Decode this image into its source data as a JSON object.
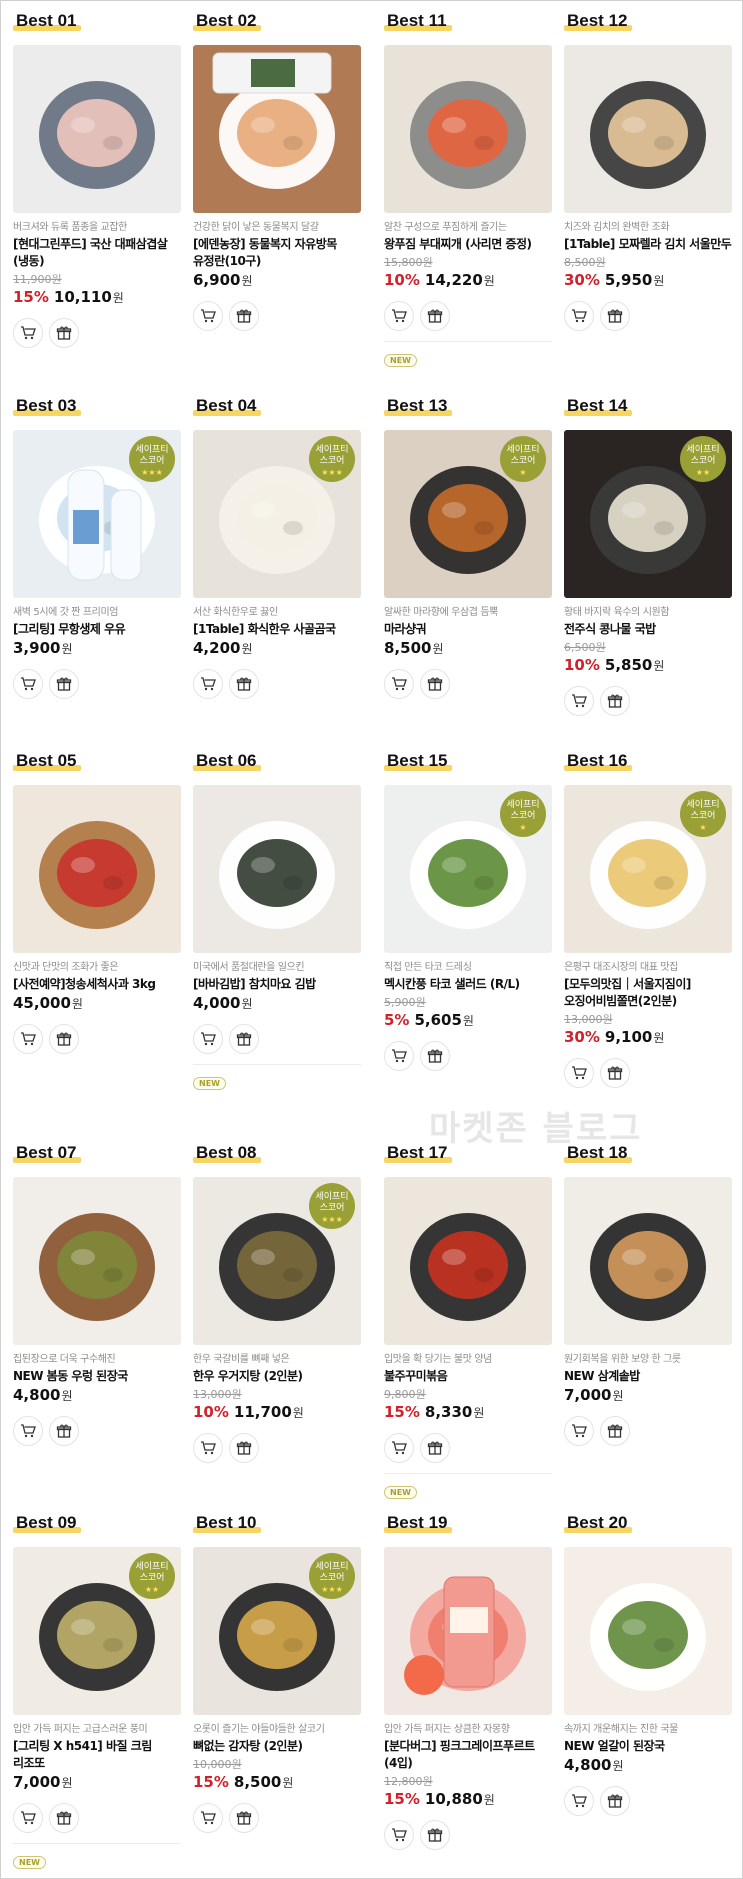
{
  "labels": {
    "safety_line1": "세이프티",
    "safety_line2": "스코어",
    "new_tag": "NEW",
    "currency": "원"
  },
  "watermark": "마켓존 블로그",
  "products": [
    {
      "rank": "Best 01",
      "desc": "버크셔와 듀록 품종을 교잡한",
      "name": "[현대그린푸드] 국산 대패삼겹살(냉동)",
      "orig": "11,900원",
      "discount": "15%",
      "price": "10,110",
      "safety": false,
      "is_new": false
    },
    {
      "rank": "Best 02",
      "desc": "건강한 닭이 낳은 동물복지 달걀",
      "name": "[에덴농장] 동물복지 자유방목 유정란(10구)",
      "orig": "",
      "discount": "",
      "price": "6,900",
      "safety": false,
      "is_new": false
    },
    {
      "rank": "Best 11",
      "desc": "알찬 구성으로 푸짐하게 즐기는",
      "name": "왕푸짐 부대찌개 (사리면 증정)",
      "orig": "15,800원",
      "discount": "10%",
      "price": "14,220",
      "safety": false,
      "is_new": true
    },
    {
      "rank": "Best 12",
      "desc": "치즈와 김치의 완벽한 조화",
      "name": "[1Table] 모짜렐라 김치 서울만두",
      "orig": "8,500원",
      "discount": "30%",
      "price": "5,950",
      "safety": false,
      "is_new": false
    },
    {
      "rank": "Best 03",
      "desc": "새벽 5시에 갓 짠 프리미엄",
      "name": "[그리팅] 무항생제 우유",
      "orig": "",
      "discount": "",
      "price": "3,900",
      "safety": true,
      "stars": "★★★",
      "is_new": false
    },
    {
      "rank": "Best 04",
      "desc": "서산 화식한우로 끓인",
      "name": "[1Table] 화식한우 사골곰국",
      "orig": "",
      "discount": "",
      "price": "4,200",
      "safety": true,
      "stars": "★★★",
      "is_new": false
    },
    {
      "rank": "Best 13",
      "desc": "알싸한 마라향에 우삼겹 듬뿍",
      "name": "마라샹궈",
      "orig": "",
      "discount": "",
      "price": "8,500",
      "safety": true,
      "stars": "★",
      "is_new": false
    },
    {
      "rank": "Best 14",
      "desc": "황태 바지락 육수의 시원함",
      "name": "전주식 콩나물 국밥",
      "orig": "6,500원",
      "discount": "10%",
      "price": "5,850",
      "safety": true,
      "stars": "★★",
      "is_new": false
    },
    {
      "rank": "Best 05",
      "desc": "신맛과 단맛의 조화가 좋은",
      "name": "[사전예약]청송세척사과 3kg",
      "orig": "",
      "discount": "",
      "price": "45,000",
      "safety": false,
      "is_new": false
    },
    {
      "rank": "Best 06",
      "desc": "미국에서 품절대란을 일으킨",
      "name": "[바바김밥] 참치마요 김밥",
      "orig": "",
      "discount": "",
      "price": "4,000",
      "safety": false,
      "is_new": true
    },
    {
      "rank": "Best 15",
      "desc": "직접 만든 타코 드레싱",
      "name": "멕시칸풍 타코 샐러드 (R/L)",
      "orig": "5,900원",
      "discount": "5%",
      "price": "5,605",
      "safety": true,
      "stars": "★",
      "is_new": false
    },
    {
      "rank": "Best 16",
      "desc": "은평구 대조시장의 대표 맛집",
      "name": "[모두의맛집｜서울지짐이] 오징어비빔쫄면(2인분)",
      "orig": "13,000원",
      "discount": "30%",
      "price": "9,100",
      "safety": true,
      "stars": "★",
      "is_new": false
    },
    {
      "rank": "Best 07",
      "desc": "집된장으로 더욱 구수해진",
      "name": "NEW 봄동 우렁 된장국",
      "orig": "",
      "discount": "",
      "price": "4,800",
      "safety": false,
      "is_new": false
    },
    {
      "rank": "Best 08",
      "desc": "한우 국갈비를 뼈째 넣은",
      "name": "한우 우거지탕 (2인분)",
      "orig": "13,000원",
      "discount": "10%",
      "price": "11,700",
      "safety": true,
      "stars": "★★★",
      "is_new": false
    },
    {
      "rank": "Best 17",
      "desc": "입맛을 확 당기는 불맛 양념",
      "name": "불주꾸미볶음",
      "orig": "9,800원",
      "discount": "15%",
      "price": "8,330",
      "safety": false,
      "is_new": true
    },
    {
      "rank": "Best 18",
      "desc": "원기회복을 위한 보양 한 그릇",
      "name": "NEW 삼계솥밥",
      "orig": "",
      "discount": "",
      "price": "7,000",
      "safety": false,
      "is_new": false
    },
    {
      "rank": "Best 09",
      "desc": "입안 가득 퍼지는 고급스러운 풍미",
      "name": "[그리팅 X h541] 바질 크림 리조또",
      "orig": "",
      "discount": "",
      "price": "7,000",
      "safety": true,
      "stars": "★★",
      "is_new": true
    },
    {
      "rank": "Best 10",
      "desc": "오롯이 즐기는 야들야들한 살코기",
      "name": "뼈없는 감자탕 (2인분)",
      "orig": "10,000원",
      "discount": "15%",
      "price": "8,500",
      "safety": true,
      "stars": "★★★",
      "is_new": false
    },
    {
      "rank": "Best 19",
      "desc": "입안 가득 퍼지는 상큼한 자몽향",
      "name": "[분다버그] 핑크그레이프푸르트 (4입)",
      "orig": "12,800원",
      "discount": "15%",
      "price": "10,880",
      "safety": false,
      "is_new": false
    },
    {
      "rank": "Best 20",
      "desc": "속까지 개운해지는 진한 국물",
      "name": "NEW 얼갈이 된장국",
      "orig": "",
      "discount": "",
      "price": "4,800",
      "safety": false,
      "is_new": false
    }
  ]
}
